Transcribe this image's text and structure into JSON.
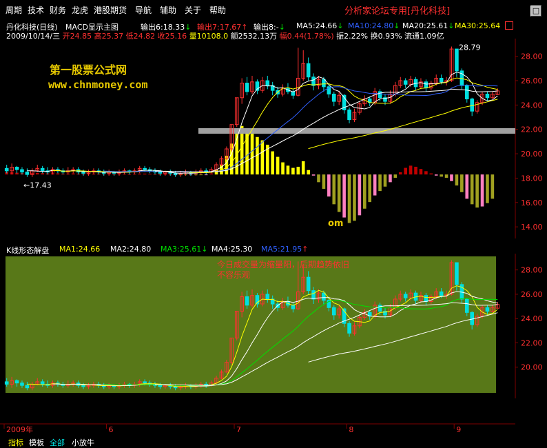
{
  "menu": {
    "items": [
      "周期",
      "技术",
      "财务",
      "龙虎",
      "港股期货",
      "导航",
      "辅助",
      "关于",
      "帮助"
    ],
    "forum_prefix": "分析家论坛专用",
    "forum_stock": "[丹化科技]"
  },
  "window_buttons": [
    "□",
    "×"
  ],
  "main": {
    "title": "丹化科技(日线)",
    "indicator": "MACD显示主图",
    "out1": "输出6:18.33",
    "out2": "输出7:17.67",
    "out3": "输出8:-",
    "ma5": "MA5:24.66",
    "ma10": "MA10:24.80",
    "ma20": "MA20:25.61",
    "ma30": "MA30:25.64",
    "quote_date": "2009/10/14/三",
    "open_label": "开",
    "open": "24.85",
    "high_label": "高",
    "high": "25.37",
    "low_label": "低",
    "low": "24.82",
    "close_label": "收",
    "close": "25.16",
    "vol_label": "量",
    "vol": "10108.0",
    "amount_label": "额",
    "amount": "2532.13万",
    "chg_label": "幅",
    "chg": "0.44(1.78%)",
    "amp_label": "振",
    "amp": "2.22%",
    "turn_label": "换",
    "turn": "0.93%",
    "float_label": "流通",
    "float": "1.09亿",
    "watermark_title": "第一股票公式网",
    "watermark_url": "www.chnmoney.com",
    "watermark_frag": "om",
    "high_marker": "28.79",
    "low_marker": "17.43",
    "y_ticks": [
      "28.00",
      "26.00",
      "24.00",
      "22.00",
      "20.00",
      "18.00",
      "16.00",
      "14.00"
    ]
  },
  "sub": {
    "title": "K线形态解盘",
    "ma1": "MA1:24.66",
    "ma2": "MA2:24.80",
    "ma3": "MA3:25.61",
    "ma4": "MA4:25.30",
    "ma5": "MA5:21.95",
    "commentary_line1": "今日成交量为缩量阳，后期趋势依旧",
    "commentary_line2": "不容乐观",
    "y_ticks": [
      "28.00",
      "26.00",
      "24.00",
      "22.00",
      "20.00"
    ]
  },
  "time_axis": [
    "2009年",
    "6",
    "7",
    "8",
    "9"
  ],
  "bottom_tabs": [
    "指标",
    "模板",
    "全部",
    "小放牛"
  ],
  "colors": {
    "up": "#ff3030",
    "down": "#00e0e0",
    "ma_white": "#ffffff",
    "ma_yellow": "#ffff00",
    "ma_blue": "#3060ff",
    "ma_green": "#00e000",
    "sub_bg": "#587818",
    "grid": "#800000"
  },
  "chart_data": {
    "type": "candlestick",
    "title": "丹化科技(日线)",
    "xlabel": "",
    "ylabel": "",
    "x_labels": [
      "2009年",
      "6",
      "7",
      "8",
      "9"
    ],
    "ylim": [
      13.5,
      29.0
    ],
    "candles": [
      [
        18.8,
        18.6,
        19.1,
        18.4
      ],
      [
        18.6,
        18.9,
        19.2,
        18.3
      ],
      [
        18.9,
        18.7,
        19.0,
        18.4
      ],
      [
        18.7,
        18.5,
        18.9,
        18.3
      ],
      [
        18.5,
        18.3,
        18.8,
        18.1
      ],
      [
        18.3,
        18.6,
        18.8,
        18.1
      ],
      [
        18.6,
        18.8,
        19.1,
        18.5
      ],
      [
        18.8,
        18.6,
        19.0,
        18.4
      ],
      [
        18.6,
        18.5,
        18.9,
        18.3
      ],
      [
        18.5,
        18.7,
        18.9,
        18.3
      ],
      [
        18.7,
        18.6,
        18.9,
        18.4
      ],
      [
        18.6,
        18.5,
        18.8,
        18.3
      ],
      [
        18.5,
        18.6,
        18.9,
        18.3
      ],
      [
        18.6,
        18.7,
        18.9,
        18.4
      ],
      [
        18.7,
        18.5,
        18.9,
        18.3
      ],
      [
        18.5,
        18.4,
        18.7,
        18.2
      ],
      [
        18.4,
        18.5,
        18.7,
        18.2
      ],
      [
        18.5,
        18.6,
        18.8,
        18.3
      ],
      [
        18.6,
        18.5,
        18.8,
        18.3
      ],
      [
        18.5,
        18.4,
        18.7,
        18.2
      ],
      [
        18.4,
        18.5,
        18.7,
        18.2
      ],
      [
        18.5,
        18.4,
        18.6,
        18.2
      ],
      [
        18.4,
        18.5,
        18.7,
        18.2
      ],
      [
        18.5,
        18.6,
        18.8,
        18.3
      ],
      [
        18.6,
        18.5,
        18.7,
        18.3
      ],
      [
        18.5,
        18.6,
        18.8,
        18.3
      ],
      [
        18.6,
        18.8,
        19.0,
        18.4
      ],
      [
        18.8,
        18.7,
        19.0,
        18.5
      ],
      [
        18.7,
        18.6,
        18.9,
        18.4
      ],
      [
        18.6,
        18.5,
        18.8,
        18.3
      ],
      [
        18.5,
        18.4,
        18.7,
        18.2
      ],
      [
        18.4,
        18.5,
        18.6,
        18.2
      ],
      [
        18.5,
        18.4,
        18.7,
        18.2
      ],
      [
        18.4,
        18.3,
        18.6,
        18.1
      ],
      [
        18.3,
        18.4,
        18.6,
        18.1
      ],
      [
        18.4,
        18.5,
        18.7,
        18.2
      ],
      [
        18.5,
        18.4,
        18.6,
        18.2
      ],
      [
        18.4,
        18.5,
        18.7,
        18.2
      ],
      [
        18.5,
        18.6,
        18.8,
        18.3
      ],
      [
        18.6,
        18.5,
        18.8,
        18.3
      ],
      [
        18.5,
        18.7,
        18.9,
        18.4
      ],
      [
        18.7,
        19.1,
        19.3,
        18.6
      ],
      [
        19.1,
        19.6,
        19.8,
        19.0
      ],
      [
        19.6,
        20.4,
        20.6,
        19.5
      ],
      [
        20.4,
        22.4,
        22.4,
        20.2
      ],
      [
        22.4,
        24.6,
        24.6,
        22.2
      ],
      [
        24.6,
        25.8,
        26.2,
        24.1
      ],
      [
        25.8,
        25.1,
        26.3,
        24.8
      ],
      [
        25.1,
        25.9,
        26.4,
        24.9
      ],
      [
        25.9,
        25.2,
        26.1,
        24.9
      ],
      [
        25.2,
        26.0,
        26.3,
        25.0
      ],
      [
        26.0,
        25.6,
        26.4,
        25.3
      ],
      [
        25.6,
        25.2,
        25.9,
        24.8
      ],
      [
        25.2,
        24.9,
        25.5,
        24.6
      ],
      [
        24.9,
        25.4,
        25.7,
        24.7
      ],
      [
        25.4,
        25.1,
        25.8,
        24.9
      ],
      [
        25.1,
        24.8,
        25.3,
        24.5
      ],
      [
        24.8,
        26.2,
        28.7,
        24.7
      ],
      [
        26.2,
        27.4,
        28.5,
        26.0
      ],
      [
        27.4,
        26.3,
        27.9,
        26.0
      ],
      [
        26.3,
        25.6,
        26.6,
        25.2
      ],
      [
        25.6,
        26.1,
        26.4,
        25.3
      ],
      [
        26.1,
        25.5,
        26.3,
        25.1
      ],
      [
        25.5,
        24.9,
        25.8,
        24.6
      ],
      [
        24.9,
        24.3,
        25.1,
        23.9
      ],
      [
        24.3,
        24.8,
        25.1,
        24.0
      ],
      [
        24.8,
        23.6,
        24.9,
        23.3
      ],
      [
        23.6,
        22.8,
        23.8,
        22.5
      ],
      [
        22.8,
        23.4,
        23.7,
        22.6
      ],
      [
        23.4,
        24.1,
        24.3,
        23.2
      ],
      [
        24.1,
        24.5,
        24.8,
        23.9
      ],
      [
        24.5,
        24.2,
        24.7,
        23.9
      ],
      [
        24.2,
        25.1,
        25.4,
        24.0
      ],
      [
        25.1,
        24.6,
        25.3,
        24.3
      ],
      [
        24.6,
        24.3,
        24.9,
        24.0
      ],
      [
        24.3,
        24.9,
        25.2,
        24.1
      ],
      [
        24.9,
        25.6,
        25.9,
        24.7
      ],
      [
        25.6,
        26.0,
        26.3,
        25.4
      ],
      [
        26.0,
        25.7,
        26.2,
        25.4
      ],
      [
        25.7,
        26.1,
        26.4,
        25.5
      ],
      [
        26.1,
        25.5,
        26.3,
        25.2
      ],
      [
        25.5,
        25.9,
        26.2,
        25.3
      ],
      [
        25.9,
        25.4,
        26.1,
        25.1
      ],
      [
        25.4,
        25.8,
        26.0,
        25.2
      ],
      [
        25.8,
        26.2,
        26.5,
        25.6
      ],
      [
        26.2,
        25.9,
        26.5,
        25.7
      ],
      [
        25.9,
        26.0,
        26.3,
        25.6
      ],
      [
        26.0,
        28.6,
        28.8,
        25.9
      ],
      [
        28.6,
        26.8,
        28.6,
        26.3
      ],
      [
        26.8,
        25.6,
        27.0,
        25.3
      ],
      [
        25.6,
        24.5,
        25.7,
        24.2
      ],
      [
        24.5,
        23.5,
        24.6,
        23.1
      ],
      [
        23.5,
        24.2,
        24.4,
        23.3
      ],
      [
        24.2,
        24.9,
        25.1,
        24.0
      ],
      [
        24.9,
        24.6,
        25.1,
        24.3
      ],
      [
        24.6,
        24.9,
        25.1,
        24.5
      ],
      [
        24.85,
        25.16,
        25.37,
        24.82
      ]
    ],
    "macd": [
      0.12,
      0.1,
      0.08,
      0.06,
      0.05,
      0.06,
      0.07,
      0.06,
      0.05,
      0.06,
      0.05,
      0.04,
      0.04,
      0.05,
      0.04,
      0.03,
      0.03,
      0.04,
      0.04,
      0.03,
      0.03,
      0.02,
      0.03,
      0.03,
      0.02,
      0.03,
      0.04,
      0.04,
      0.03,
      0.02,
      0.01,
      0.01,
      0.0,
      -0.01,
      -0.01,
      -0.02,
      -0.02,
      -0.03,
      -0.02,
      -0.01,
      0.05,
      0.2,
      0.45,
      0.85,
      1.4,
      1.95,
      2.2,
      2.1,
      1.95,
      1.7,
      1.55,
      1.35,
      1.05,
      0.8,
      0.55,
      0.4,
      0.3,
      0.35,
      0.6,
      0.2,
      -0.05,
      -0.35,
      -0.65,
      -1.0,
      -1.35,
      -1.7,
      -1.95,
      -2.2,
      -2.1,
      -1.85,
      -1.55,
      -1.25,
      -0.95,
      -0.75,
      -0.55,
      -0.35,
      -0.15,
      0.1,
      0.3,
      0.4,
      0.35,
      0.25,
      0.15,
      0.05,
      -0.05,
      -0.1,
      -0.15,
      -0.3,
      -0.5,
      -0.8,
      -1.1,
      -1.35,
      -1.5,
      -1.45,
      -1.3,
      -1.1
    ]
  }
}
